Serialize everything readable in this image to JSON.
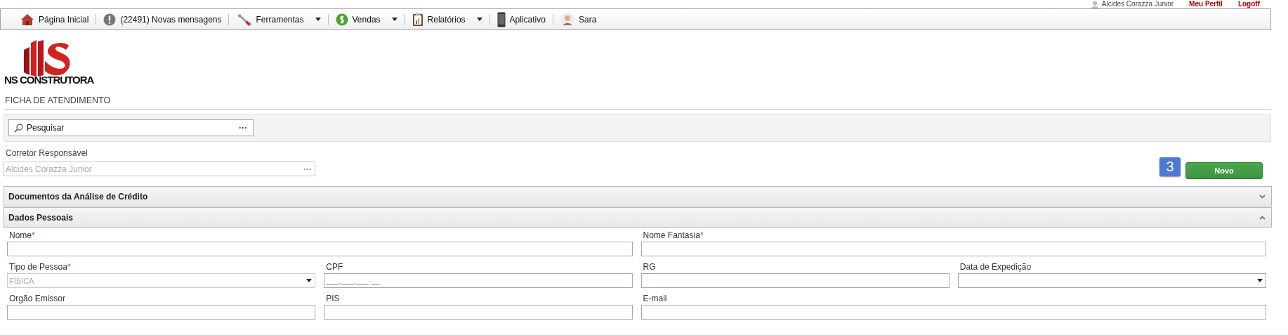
{
  "user_bar": {
    "user_name": "Alcides Corazza Junior",
    "links": [
      "Meu Perfil",
      "Logoff"
    ]
  },
  "nav": [
    {
      "label": "Página Inicial",
      "dropdown": false
    },
    {
      "label": "(22491) Novas mensagens",
      "dropdown": false
    },
    {
      "label": "Ferramentas",
      "dropdown": true
    },
    {
      "label": "Vendas",
      "dropdown": true
    },
    {
      "label": "Relatórios",
      "dropdown": true
    },
    {
      "label": "Aplicativo",
      "dropdown": false
    },
    {
      "label": "Sara",
      "dropdown": false
    }
  ],
  "logo": {
    "text": "NS CONSTRUTORA"
  },
  "page_title": "FICHA DE ATENDIMENTO",
  "search": {
    "placeholder": "Pesquisar",
    "button": "···"
  },
  "broker": {
    "label": "Corretor Responsável",
    "value": "Alcides Corazza Junior",
    "disabled": true,
    "button": "···"
  },
  "badge": "3",
  "new_button": "Novo",
  "sections": [
    {
      "title": "Documentos da Análise de Crédito",
      "expanded": false
    },
    {
      "title": "Dados Pessoais",
      "expanded": true
    }
  ],
  "required_mark": "*",
  "form_rows": [
    [
      {
        "label": "Nome",
        "required": true,
        "kind": "text"
      },
      {
        "label": "Nome Fantasia",
        "required": true,
        "kind": "text"
      }
    ],
    [
      {
        "label": "Tipo de Pessoa",
        "required": true,
        "kind": "select",
        "value": "FÍSICA",
        "disabled": true
      },
      {
        "label": "CPF",
        "required": false,
        "kind": "text",
        "placeholder": "___.___.___-__"
      },
      {
        "label": "RG",
        "required": false,
        "kind": "text"
      },
      {
        "label": "Data de Expedição",
        "required": false,
        "kind": "select"
      }
    ],
    [
      {
        "label": "Orgão Emissor",
        "required": false,
        "kind": "text"
      },
      {
        "label": "PIS",
        "required": false,
        "kind": "text"
      },
      {
        "label": "E-mail",
        "required": false,
        "kind": "text"
      }
    ]
  ]
}
